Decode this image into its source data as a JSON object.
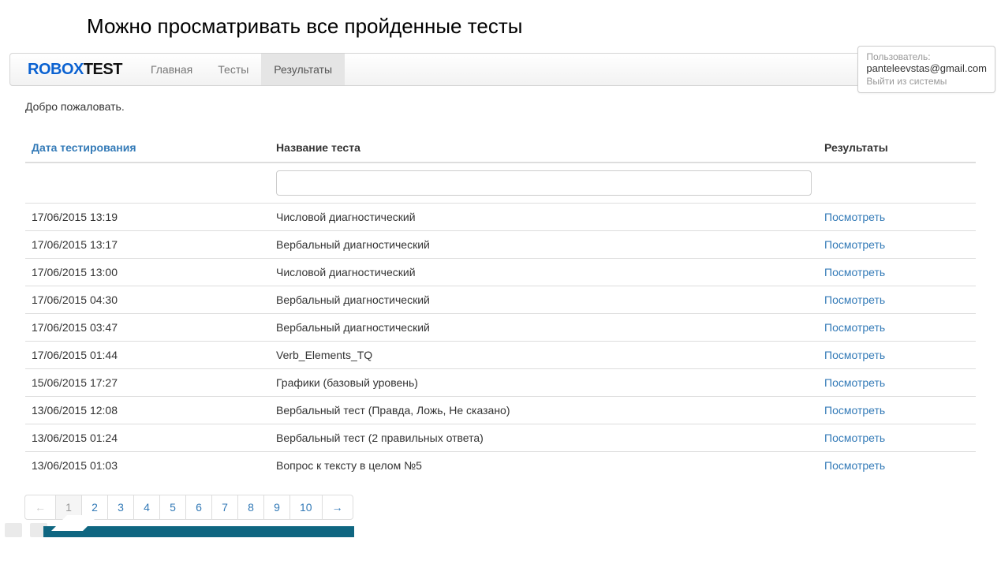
{
  "page_heading": "Можно просматривать все пройденные тесты",
  "logo": {
    "part1": "ROBOX",
    "part2": "TEST"
  },
  "nav": {
    "items": [
      {
        "label": "Главная",
        "active": false
      },
      {
        "label": "Тесты",
        "active": false
      },
      {
        "label": "Результаты",
        "active": true
      }
    ]
  },
  "user": {
    "label": "Пользователь:",
    "email": "panteleevstas@gmail.com",
    "logout": "Выйти из системы"
  },
  "welcome": "Добро пожаловать.",
  "table": {
    "headers": {
      "date": "Дата тестирования",
      "name": "Название теста",
      "result": "Результаты"
    },
    "view_label": "Посмотреть",
    "rows": [
      {
        "date": "17/06/2015 13:19",
        "name": "Числовой диагностический"
      },
      {
        "date": "17/06/2015 13:17",
        "name": "Вербальный диагностический"
      },
      {
        "date": "17/06/2015 13:00",
        "name": "Числовой диагностический"
      },
      {
        "date": "17/06/2015 04:30",
        "name": "Вербальный диагностический"
      },
      {
        "date": "17/06/2015 03:47",
        "name": "Вербальный диагностический"
      },
      {
        "date": "17/06/2015 01:44",
        "name": "Verb_Elements_TQ"
      },
      {
        "date": "15/06/2015 17:27",
        "name": "Графики (базовый уровень)"
      },
      {
        "date": "13/06/2015 12:08",
        "name": "Вербальный тест (Правда, Ложь, Не сказано)"
      },
      {
        "date": "13/06/2015 01:24",
        "name": "Вербальный тест (2 правильных ответа)"
      },
      {
        "date": "13/06/2015 01:03",
        "name": "Вопрос к тексту в целом №5"
      }
    ]
  },
  "pagination": {
    "prev": "←",
    "next": "→",
    "pages": [
      "1",
      "2",
      "3",
      "4",
      "5",
      "6",
      "7",
      "8",
      "9",
      "10"
    ],
    "active": "1"
  }
}
